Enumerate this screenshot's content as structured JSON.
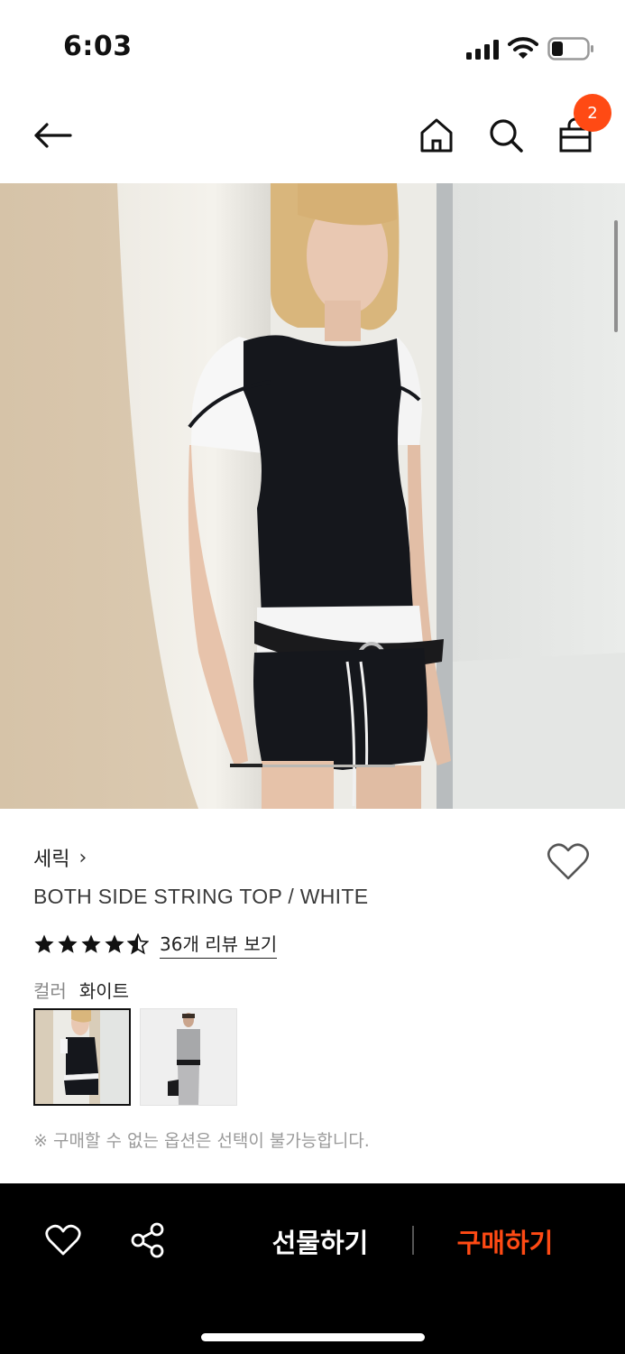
{
  "status_bar": {
    "time": "6:03",
    "icons": [
      "cellular-signal-icon",
      "wifi-icon",
      "battery-icon"
    ]
  },
  "nav": {
    "back_icon": "arrow-left-icon",
    "home_icon": "home-icon",
    "search_icon": "search-icon",
    "cart_icon": "shopping-bag-icon",
    "cart_count": "2"
  },
  "product": {
    "brand": "세릭",
    "brand_chevron": "›",
    "name": "BOTH SIDE STRING TOP / WHITE",
    "rating": 4.5,
    "review_link": "36개 리뷰 보기",
    "color_label": "컬러",
    "color_value": "화이트",
    "swatches": [
      "white-variant-swatch",
      "gray-variant-swatch"
    ],
    "notice": "※ 구매할 수 없는 옵션은 선택이 불가능합니다."
  },
  "image_gallery": {
    "current_image": 1,
    "image_count": 5
  },
  "bottom_bar": {
    "wish_icon": "heart-icon",
    "share_icon": "share-icon",
    "gift_label": "선물하기",
    "buy_label": "구매하기"
  },
  "colors": {
    "accent": "#ff4a14",
    "bottom_bar_bg": "#000000",
    "text": "#111111"
  }
}
